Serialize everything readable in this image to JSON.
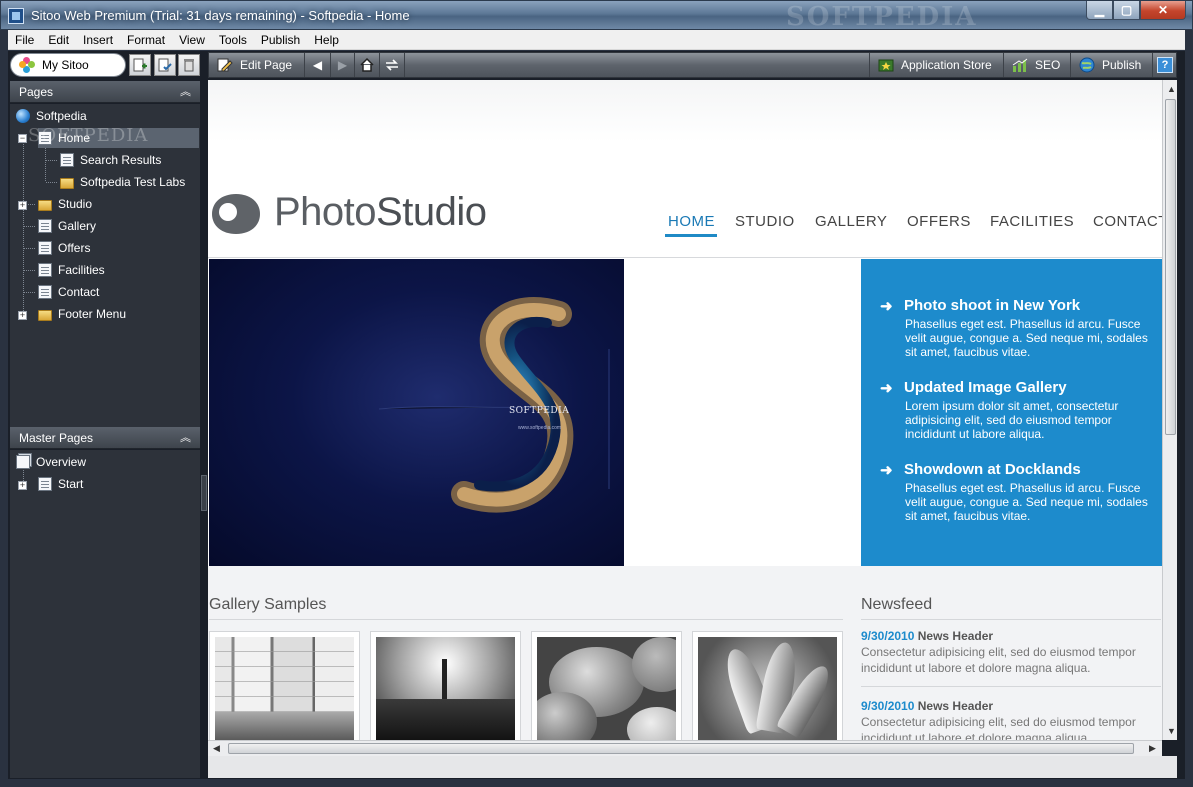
{
  "window": {
    "title": "Sitoo Web Premium (Trial: 31 days remaining) - Softpedia - Home",
    "watermark": "SOFTPEDIA"
  },
  "menu": [
    "File",
    "Edit",
    "Insert",
    "Format",
    "View",
    "Tools",
    "Publish",
    "Help"
  ],
  "left_toolbar": {
    "my_sitoo": "My Sitoo"
  },
  "pages_panel": {
    "title": "Pages",
    "items": {
      "root": "Softpedia",
      "home": "Home",
      "search_results": "Search Results",
      "test_labs": "Softpedia Test Labs",
      "studio": "Studio",
      "gallery": "Gallery",
      "offers": "Offers",
      "facilities": "Facilities",
      "contact": "Contact",
      "footer_menu": "Footer Menu"
    },
    "watermark": "SOFTPEDIA"
  },
  "master_panel": {
    "title": "Master Pages",
    "items": {
      "overview": "Overview",
      "start": "Start"
    }
  },
  "toolbar": {
    "edit_page": "Edit Page",
    "app_store": "Application Store",
    "seo": "SEO",
    "publish": "Publish",
    "help": "?"
  },
  "site": {
    "logo_photo": "Photo",
    "logo_studio": "Studio",
    "nav": {
      "home": "HOME",
      "studio": "STUDIO",
      "gallery": "GALLERY",
      "offers": "OFFERS",
      "facilities": "FACILITIES",
      "contact": "CONTACT"
    },
    "hero_caption": "SOFTPEDIA",
    "hero_sub": "www.softpedia.com",
    "hero_news": [
      {
        "title": "Photo shoot in New York",
        "body": "Phasellus eget est. Phasellus id arcu. Fusce velit augue, congue a. Sed neque mi, sodales sit amet, faucibus vitae."
      },
      {
        "title": "Updated Image Gallery",
        "body": "Lorem ipsum dolor sit amet, consectetur adipisicing elit, sed do eiusmod tempor incididunt ut labore aliqua."
      },
      {
        "title": "Showdown at Docklands",
        "body": "Phasellus eget est. Phasellus id arcu. Fusce velit augue, congue a. Sed neque mi, sodales sit amet, faucibus vitae."
      }
    ],
    "gallery_title": "Gallery Samples",
    "newsfeed_title": "Newsfeed",
    "newsfeed": [
      {
        "date": "9/30/2010",
        "header": "News Header",
        "body": "Consectetur adipisicing elit, sed do eiusmod tempor incididunt ut labore et dolore magna aliqua."
      },
      {
        "date": "9/30/2010",
        "header": "News Header",
        "body": "Consectetur adipisicing elit, sed do eiusmod tempor incididunt ut labore et dolore magna aliqua."
      }
    ]
  },
  "colors": {
    "accent": "#1d8bcc",
    "panel": "#2d323a",
    "toolbar": "#5e646c"
  }
}
